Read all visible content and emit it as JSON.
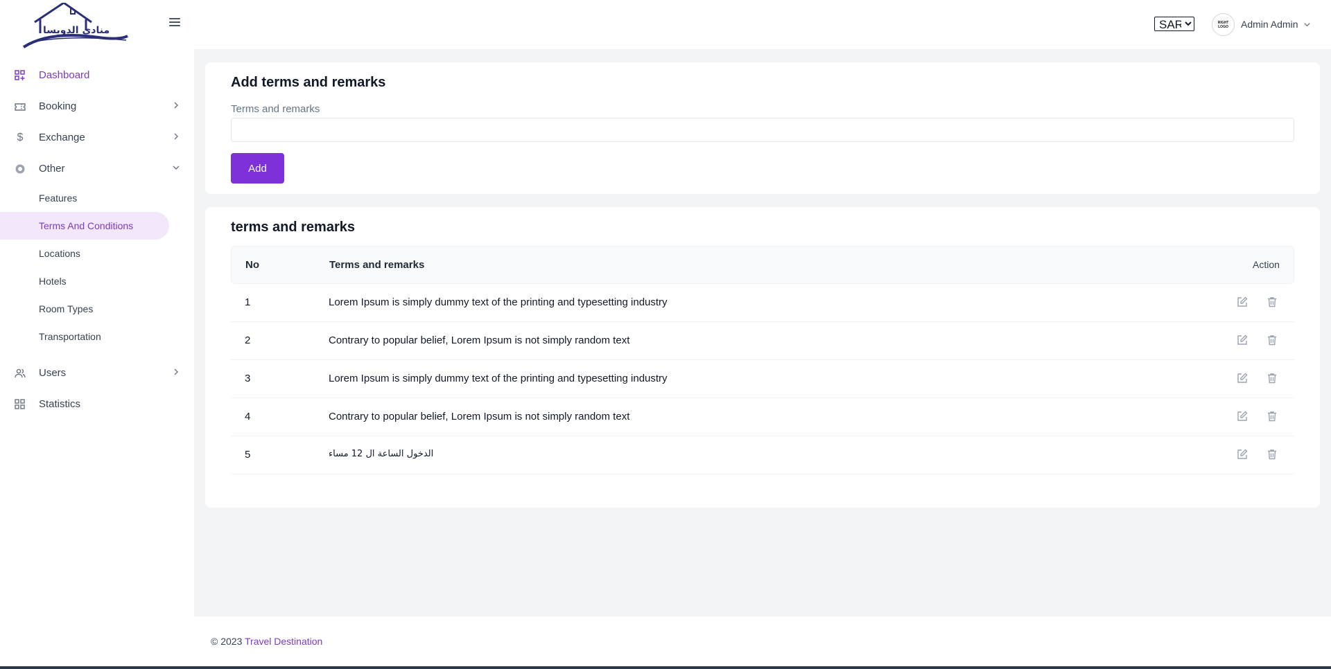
{
  "brand": {
    "logo_alt_text": "منادي الدويسا"
  },
  "sidebar": {
    "items": [
      {
        "label": "Dashboard",
        "icon": "dashboard-icon",
        "active": true
      },
      {
        "label": "Booking",
        "icon": "ticket-icon",
        "has_children": true
      },
      {
        "label": "Exchange",
        "icon": "dollar-icon",
        "has_children": true
      },
      {
        "label": "Other",
        "icon": "circle-icon",
        "has_children": true,
        "expanded": true
      }
    ],
    "other_children": [
      {
        "label": "Features"
      },
      {
        "label": "Terms And Conditions",
        "active": true
      },
      {
        "label": "Locations"
      },
      {
        "label": "Hotels"
      },
      {
        "label": "Room Types"
      },
      {
        "label": "Transportation"
      }
    ],
    "bottom_items": [
      {
        "label": "Users",
        "icon": "users-icon",
        "has_children": true
      },
      {
        "label": "Statistics",
        "icon": "grid-icon"
      }
    ]
  },
  "header": {
    "currency": {
      "selected": "SAR"
    },
    "avatar_text": "RIGHT LOGO",
    "user_name": "Admin Admin"
  },
  "add_form": {
    "title": "Add terms and remarks",
    "field_label": "Terms and remarks",
    "field_value": "",
    "button_label": "Add"
  },
  "list": {
    "title": "terms and remarks",
    "columns": {
      "no": "No",
      "terms": "Terms and remarks",
      "action": "Action"
    },
    "rows": [
      {
        "no": "1",
        "text": "Lorem Ipsum is simply dummy text of the printing and typesetting industry"
      },
      {
        "no": "2",
        "text": "Contrary to popular belief, Lorem Ipsum is not simply random text"
      },
      {
        "no": "3",
        "text": "Lorem Ipsum is simply dummy text of the printing and typesetting industry"
      },
      {
        "no": "4",
        "text": "Contrary to popular belief, Lorem Ipsum is not simply random text"
      },
      {
        "no": "5",
        "text": "الدخول الساعة ال 12 مساء"
      }
    ]
  },
  "footer": {
    "copyright": "© 2023",
    "link_text": "Travel Destination"
  },
  "colors": {
    "accent": "#7e30d9",
    "active_text": "#7e3ac2",
    "active_bg": "#f3e8fb",
    "page_bg": "#f3f4f6"
  }
}
